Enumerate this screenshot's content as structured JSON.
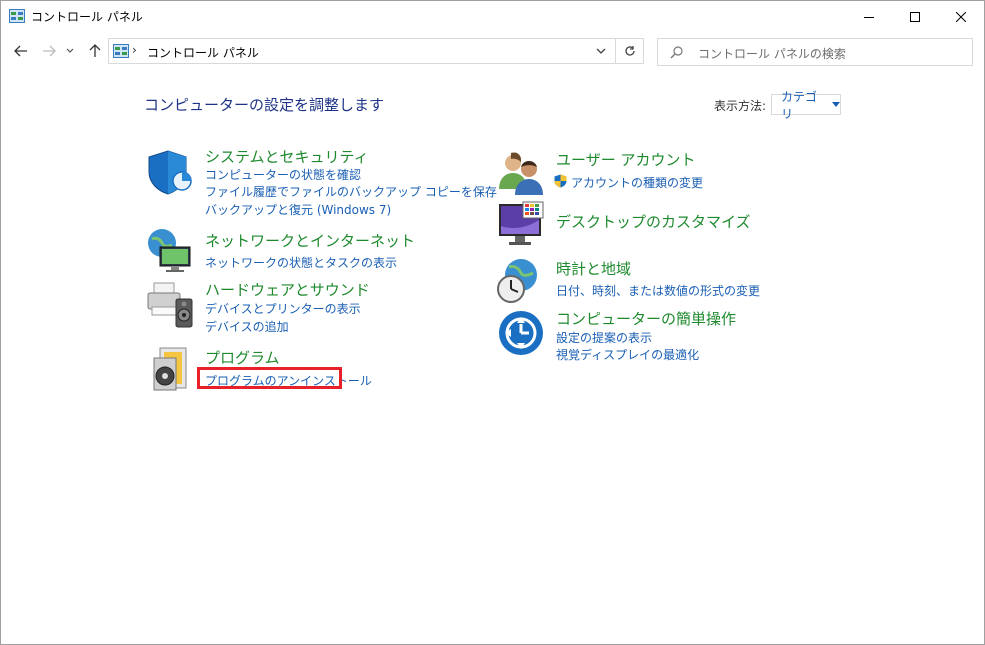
{
  "window": {
    "title": "コントロール パネル",
    "buttons": {
      "minimize": "minimize-icon",
      "maximize": "maximize-icon",
      "close": "close-icon"
    }
  },
  "address_bar": {
    "separator": "›",
    "location": "コントロール パネル",
    "search_placeholder": "コントロール パネルの検索"
  },
  "main": {
    "heading": "コンピューターの設定を調整します",
    "view_by_label": "表示方法:",
    "view_by_value": "カテゴリ"
  },
  "categories": {
    "system": {
      "title": "システムとセキュリティ",
      "links": [
        "コンピューターの状態を確認",
        "ファイル履歴でファイルのバックアップ コピーを保存",
        "バックアップと復元 (Windows 7)"
      ]
    },
    "network": {
      "title": "ネットワークとインターネット",
      "links": [
        "ネットワークの状態とタスクの表示"
      ]
    },
    "hardware": {
      "title": "ハードウェアとサウンド",
      "links": [
        "デバイスとプリンターの表示",
        "デバイスの追加"
      ]
    },
    "programs": {
      "title": "プログラム",
      "links": [
        "プログラムのアンインストール"
      ]
    },
    "user_accounts": {
      "title": "ユーザー アカウント",
      "links": [
        "アカウントの種類の変更"
      ]
    },
    "appearance": {
      "title": "デスクトップのカスタマイズ",
      "links": []
    },
    "clock": {
      "title": "時計と地域",
      "links": [
        "日付、時刻、または数値の形式の変更"
      ]
    },
    "ease": {
      "title": "コンピューターの簡単操作",
      "links": [
        "設定の提案の表示",
        "視覚ディスプレイの最適化"
      ]
    }
  },
  "colors": {
    "category_title": "#1e8a2e",
    "link": "#1a5fb4",
    "heading": "#1e3287",
    "highlight_border": "#e8202a"
  }
}
